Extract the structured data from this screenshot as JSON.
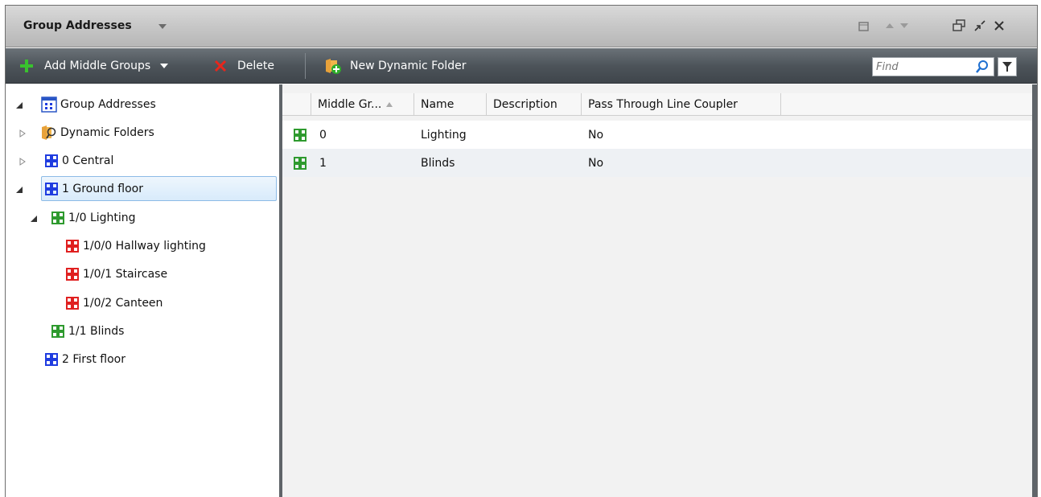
{
  "panel": {
    "title": "Group Addresses"
  },
  "toolbar": {
    "add_label": "Add Middle Groups",
    "delete_label": "Delete",
    "new_folder_label": "New Dynamic Folder",
    "find_placeholder": "Find"
  },
  "tree": {
    "root": "Group Addresses",
    "items": [
      {
        "label": "Dynamic Folders",
        "icon": "dynamic-folder-icon"
      },
      {
        "label": "0 Central",
        "icon": "main-group-icon",
        "color": "#1f3ce0"
      },
      {
        "label": "1 Ground floor",
        "icon": "main-group-icon",
        "color": "#1f3ce0"
      },
      {
        "label": "1/0 Lighting",
        "icon": "middle-group-icon",
        "color": "#2e9a2e"
      },
      {
        "label": "1/0/0 Hallway lighting",
        "icon": "group-address-icon",
        "color": "#e02020"
      },
      {
        "label": "1/0/1 Staircase",
        "icon": "group-address-icon",
        "color": "#e02020"
      },
      {
        "label": "1/0/2 Canteen",
        "icon": "group-address-icon",
        "color": "#e02020"
      },
      {
        "label": "1/1 Blinds",
        "icon": "middle-group-icon",
        "color": "#2e9a2e"
      },
      {
        "label": "2 First floor",
        "icon": "main-group-icon",
        "color": "#1f3ce0"
      }
    ]
  },
  "grid": {
    "columns": [
      "Middle Gr...",
      "Name",
      "Description",
      "Pass Through Line Coupler"
    ],
    "rows": [
      {
        "middle_group": "0",
        "name": "Lighting",
        "description": "",
        "pass_through": "No"
      },
      {
        "middle_group": "1",
        "name": "Blinds",
        "description": "",
        "pass_through": "No"
      }
    ]
  },
  "colors": {
    "main_group": "#1f3ce0",
    "middle_group": "#2e9a2e",
    "group_address": "#e02020",
    "selection": "#d8ebfb"
  }
}
